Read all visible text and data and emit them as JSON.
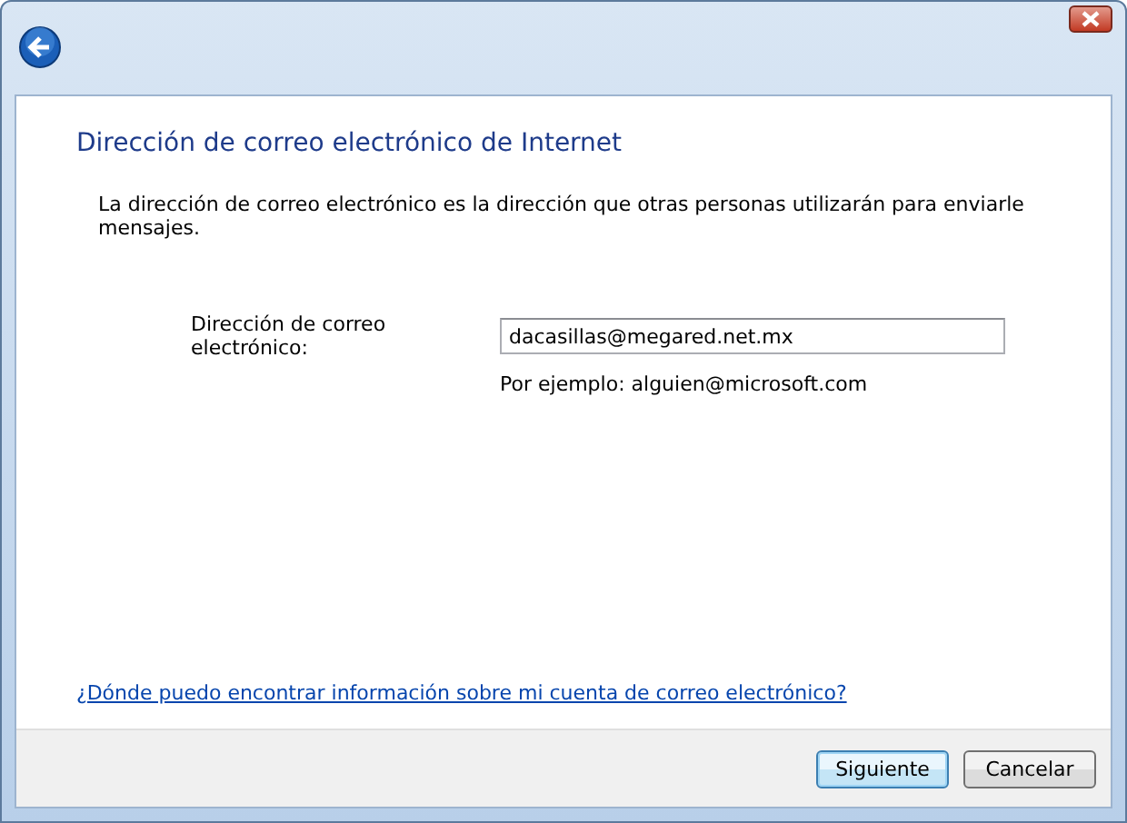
{
  "heading": "Dirección de correo electrónico de Internet",
  "description": "La dirección de correo electrónico es la dirección que otras personas utilizarán para enviarle mensajes.",
  "email_field": {
    "label": "Dirección de correo electrónico:",
    "value": "dacasillas@megared.net.mx",
    "hint": "Por ejemplo: alguien@microsoft.com"
  },
  "help_link": "¿Dónde puedo encontrar información sobre mi cuenta de correo electrónico?",
  "buttons": [
    {
      "label": "Siguiente",
      "selected": true
    },
    {
      "label": "Cancelar",
      "selected": false
    }
  ]
}
